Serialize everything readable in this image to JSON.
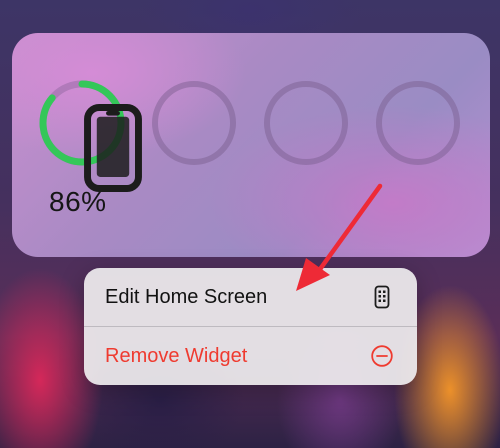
{
  "widget": {
    "battery_percent_label": "86%",
    "battery_level": 0.86,
    "device_icon": "iphone-icon",
    "empty_slots": 3
  },
  "menu": {
    "items": [
      {
        "label": "Edit Home Screen",
        "icon": "home-screen-grid-icon",
        "color": "#121212"
      },
      {
        "label": "Remove Widget",
        "icon": "minus-circle-icon",
        "color": "#ef3b30"
      }
    ]
  },
  "colors": {
    "battery_ring": "#34c759",
    "destructive": "#ef3b30",
    "annotation_arrow": "#ee2a36"
  }
}
